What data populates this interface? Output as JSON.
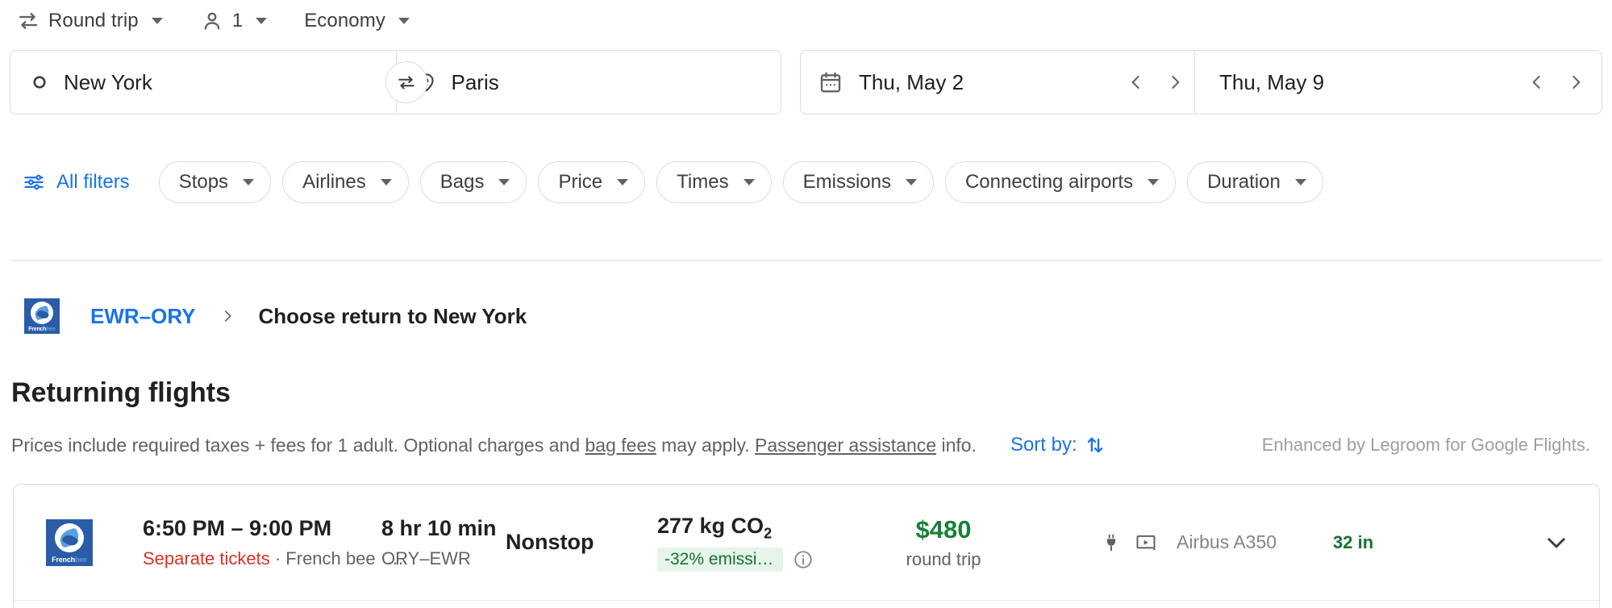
{
  "trip_options": [
    {
      "icon": "swap-horizontal-icon",
      "label": "Round trip",
      "name": "trip-type-selector"
    },
    {
      "icon": "person-icon",
      "label": "1",
      "name": "passengers-selector"
    },
    {
      "icon": "",
      "label": "Economy",
      "name": "cabin-class-selector"
    }
  ],
  "search": {
    "origin": {
      "label": "New York",
      "icon": "circle-icon"
    },
    "destination": {
      "label": "Paris",
      "icon": "location-pin-icon"
    },
    "swap_icon": "swap-arrows-icon",
    "departure_date": "Thu, May 2",
    "return_date": "Thu, May 9",
    "calendar_icon": "calendar-icon",
    "prev_icon": "chevron-left-icon",
    "next_icon": "chevron-right-icon"
  },
  "filters": {
    "all_filters_label": "All filters",
    "tune_icon": "tune-icon",
    "chips": [
      {
        "label": "Stops"
      },
      {
        "label": "Airlines"
      },
      {
        "label": "Bags"
      },
      {
        "label": "Price"
      },
      {
        "label": "Times"
      },
      {
        "label": "Emissions"
      },
      {
        "label": "Connecting airports"
      },
      {
        "label": "Duration"
      }
    ]
  },
  "breadcrumb": {
    "airline_logo": "french-bee-logo",
    "logo_word_1": "French",
    "logo_word_2": "bee",
    "route_link": "EWR–ORY",
    "separator_icon": "chevron-right-icon",
    "current": "Choose return to New York"
  },
  "section": {
    "title": "Returning flights",
    "disclaimer_part1": "Prices include required taxes + fees for 1 adult. Optional charges and ",
    "disclaimer_link1": "bag fees",
    "disclaimer_part2": " may apply. ",
    "disclaimer_link2": "Passenger assistance",
    "disclaimer_part3": " info.",
    "sort_by_label": "Sort by:",
    "sort_icon": "sort-arrows-icon",
    "legroom_note": "Enhanced by Legroom for Google Flights."
  },
  "flights": [
    {
      "logo": "french-bee-logo",
      "times": "6:50 PM – 9:00 PM",
      "separate_tickets": "Separate tickets",
      "operator_line": " · French bee ·…",
      "duration": "8 hr 10 min",
      "route": "ORY–EWR",
      "stops": "Nonstop",
      "emissions": "277 kg CO",
      "emissions_sub": "2",
      "emissions_badge": "-32% emissio…",
      "info_icon": "info-icon",
      "price": "$480",
      "trip_type": "round trip",
      "amenity_icons": [
        "power-outlet-icon",
        "video-screen-icon"
      ],
      "aircraft": "Airbus A350",
      "legroom": "32 in",
      "expand_icon": "chevron-down-icon"
    }
  ],
  "colors": {
    "accent_blue": "#1a73e8",
    "green": "#188038",
    "badge_green_bg": "#e6f4ea",
    "badge_green_text": "#137333",
    "warning_red": "#d93025",
    "border": "#dadce0",
    "muted_text": "#5f6368",
    "logo_blue": "#2b5ca8"
  }
}
